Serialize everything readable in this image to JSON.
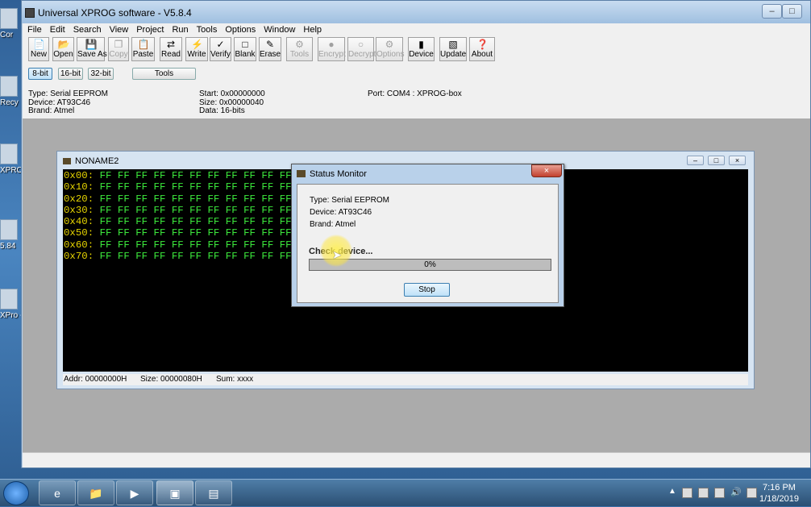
{
  "window": {
    "title": "Universal XPROG software - V5.8.4"
  },
  "menu": [
    "File",
    "Edit",
    "Search",
    "View",
    "Project",
    "Run",
    "Tools",
    "Options",
    "Window",
    "Help"
  ],
  "toolbar": [
    {
      "label": "New",
      "icon": "new-file-icon",
      "enabled": true
    },
    {
      "label": "Open",
      "icon": "open-folder-icon",
      "enabled": true
    },
    {
      "label": "Save As",
      "icon": "save-as-icon",
      "enabled": true
    },
    {
      "label": "Copy",
      "icon": "copy-icon",
      "enabled": false
    },
    {
      "label": "Paste",
      "icon": "paste-icon",
      "enabled": true
    },
    {
      "label": "Read",
      "icon": "read-icon",
      "enabled": true
    },
    {
      "label": "Write",
      "icon": "write-icon",
      "enabled": true
    },
    {
      "label": "Verify",
      "icon": "verify-icon",
      "enabled": true
    },
    {
      "label": "Blank",
      "icon": "blank-icon",
      "enabled": true
    },
    {
      "label": "Erase",
      "icon": "erase-icon",
      "enabled": true
    },
    {
      "label": "Tools",
      "icon": "tools-icon",
      "enabled": false
    },
    {
      "label": "Encrypt",
      "icon": "encrypt-icon",
      "enabled": false
    },
    {
      "label": "Decrypt",
      "icon": "decrypt-icon",
      "enabled": false
    },
    {
      "label": "Options",
      "icon": "options-icon",
      "enabled": false
    },
    {
      "label": "Device",
      "icon": "device-icon",
      "enabled": true
    },
    {
      "label": "Update",
      "icon": "update-icon",
      "enabled": true
    },
    {
      "label": "About",
      "icon": "about-icon",
      "enabled": true
    }
  ],
  "bitmode": {
    "b8": "8-bit",
    "b16": "16-bit",
    "b32": "32-bit",
    "tools": "Tools"
  },
  "info": {
    "type": "Type: Serial EEPROM",
    "device": "Device: AT93C46",
    "brand": "Brand: Atmel",
    "start": "Start: 0x00000000",
    "size": "Size: 0x00000040",
    "data": "Data: 16-bits",
    "port": "Port: COM4 : XPROG-box"
  },
  "child": {
    "title": "NONAME2",
    "rows": [
      {
        "addr": "0x00:",
        "values": "FF FF FF FF FF FF FF FF FF FF FF FF FF FF FF FF"
      },
      {
        "addr": "0x10:",
        "values": "FF FF FF FF FF FF FF FF FF FF FF FF FF FF FF FF"
      },
      {
        "addr": "0x20:",
        "values": "FF FF FF FF FF FF FF FF FF FF FF FF FF FF FF FF"
      },
      {
        "addr": "0x30:",
        "values": "FF FF FF FF FF FF FF FF FF FF FF FF FF FF FF FF"
      },
      {
        "addr": "0x40:",
        "values": "FF FF FF FF FF FF FF FF FF FF FF FF FF FF FF FF"
      },
      {
        "addr": "0x50:",
        "values": "FF FF FF FF FF FF FF FF FF FF FF FF FF FF FF FF"
      },
      {
        "addr": "0x60:",
        "values": "FF FF FF FF FF FF FF FF FF FF FF FF FF FF FF FF"
      },
      {
        "addr": "0x70:",
        "values": "FF FF FF FF FF FF FF FF FF FF FF FF FF FF FF FF"
      }
    ],
    "status": {
      "addr": "Addr: 00000000H",
      "size": "Size: 00000080H",
      "sum": "Sum: xxxx"
    }
  },
  "modal": {
    "title": "Status Monitor",
    "type": "Type: Serial EEPROM",
    "device": "Device: AT93C46",
    "brand": "Brand: Atmel",
    "message": "Check device...",
    "progress_label": "0%",
    "progress_fraction": 0,
    "stop": "Stop"
  },
  "desktop_labels": [
    "Cor",
    "Recy",
    "XPRO",
    "5.84",
    "XPro - Sl"
  ],
  "taskbar": {
    "time": "7:16 PM",
    "date": "1/18/2019"
  }
}
